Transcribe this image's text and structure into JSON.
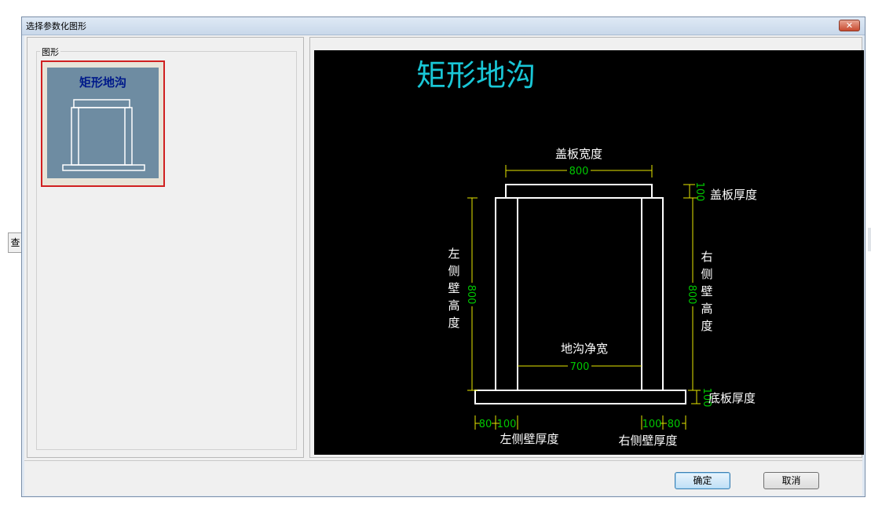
{
  "background": {
    "left_tab_label": "查"
  },
  "dialog": {
    "title": "选择参数化图形",
    "close_label": "✕"
  },
  "gallery": {
    "group_label": "图形",
    "items": [
      {
        "label": "矩形地沟",
        "selected": true
      }
    ]
  },
  "preview": {
    "title": "矩形地沟",
    "cover_width_label": "盖板宽度",
    "cover_width_value": "800",
    "cover_thickness_label": "盖板厚度",
    "cover_thickness_value": "100",
    "left_wall_height_label": [
      "左",
      "侧",
      "壁",
      "高",
      "度"
    ],
    "left_wall_height_value": "800",
    "right_wall_height_label": [
      "右",
      "侧",
      "壁",
      "高",
      "度"
    ],
    "right_wall_height_value": "800",
    "clear_width_label": "地沟净宽",
    "clear_width_value": "700",
    "base_thickness_label": "底板厚度",
    "base_thickness_value": "100",
    "left_overhang_value": "80",
    "left_wall_thickness_value": "100",
    "left_wall_thickness_label": "左侧壁厚度",
    "right_wall_thickness_value": "100",
    "right_overhang_value": "80",
    "right_wall_thickness_label": "右侧壁厚度",
    "colors": {
      "title": "#19c6d6",
      "dim_line": "#e6e600",
      "dim_text": "#00c800",
      "drawing": "#ffffff"
    }
  },
  "buttons": {
    "ok": "确定",
    "cancel": "取消"
  }
}
